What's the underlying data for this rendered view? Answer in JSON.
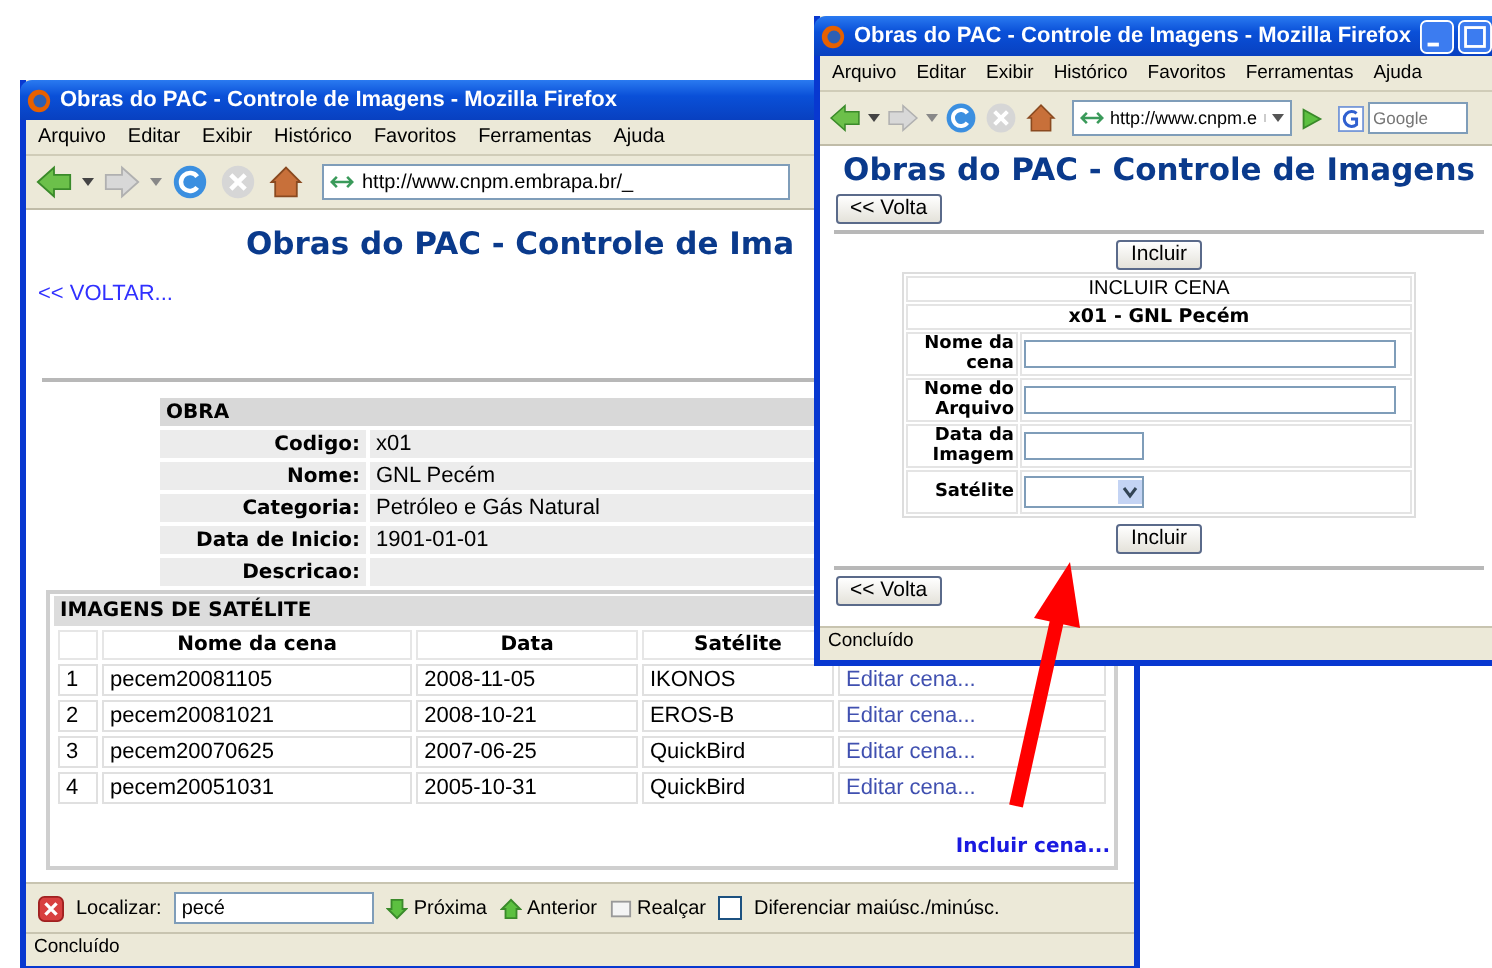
{
  "back_window": {
    "title": "Obras do PAC - Controle de Imagens - Mozilla Firefox",
    "menu": [
      "Arquivo",
      "Editar",
      "Exibir",
      "Histórico",
      "Favoritos",
      "Ferramentas",
      "Ajuda"
    ],
    "url": "http://www.cnpm.embrapa.br/_",
    "page": {
      "heading": "Obras do PAC - Controle de Ima",
      "back_link": "<< VOLTAR...",
      "obra": {
        "heading": "OBRA",
        "fields": [
          {
            "label": "Codigo:",
            "value": "x01"
          },
          {
            "label": "Nome:",
            "value": "GNL Pecém"
          },
          {
            "label": "Categoria:",
            "value": "Petróleo e Gás Natural"
          },
          {
            "label": "Data de Inicio:",
            "value": "1901-01-01"
          },
          {
            "label": "Descricao:"
          }
        ]
      },
      "images": {
        "heading": "IMAGENS DE SATÉLITE",
        "columns": [
          "Nome da cena",
          "Data",
          "Satélite"
        ],
        "rows": [
          {
            "number": "1",
            "name": "pecem20081105",
            "date": "2008-11-05",
            "satellite": "IKONOS",
            "action": "Editar cena..."
          },
          {
            "number": "2",
            "name": "pecem20081021",
            "date": "2008-10-21",
            "satellite": "EROS-B",
            "action": "Editar cena..."
          },
          {
            "number": "3",
            "name": "pecem20070625",
            "date": "2007-06-25",
            "satellite": "QuickBird",
            "action": "Editar cena..."
          },
          {
            "number": "4",
            "name": "pecem20051031",
            "date": "2005-10-31",
            "satellite": "QuickBird",
            "action": "Editar cena..."
          }
        ],
        "add_link": "Incluir cena..."
      }
    },
    "find_bar": {
      "label": "Localizar:",
      "value": "pecé",
      "next": "Próxima",
      "previous": "Anterior",
      "highlight": "Realçar",
      "match_case": {
        "label": "Diferenciar maiúsc./minúsc.",
        "checked": false
      }
    },
    "status": "Concluído"
  },
  "front_window": {
    "title": "Obras do PAC - Controle de Imagens - Mozilla Firefox",
    "menu": [
      "Arquivo",
      "Editar",
      "Exibir",
      "Histórico",
      "Favoritos",
      "Ferramentas",
      "Ajuda"
    ],
    "url": "http://www.cnpm.e",
    "search": {
      "placeholder": "Google"
    },
    "page": {
      "heading": "Obras do PAC - Controle de Imagens",
      "back_button": "<< Volta",
      "include_button": "Incluir",
      "form": {
        "title": "INCLUIR CENA",
        "subtitle": "x01 - GNL Pecém",
        "fields": [
          {
            "label": "Nome da cena",
            "kind": "text"
          },
          {
            "label": "Nome do Arquivo",
            "kind": "text"
          },
          {
            "label": "Data da Imagem",
            "kind": "date"
          },
          {
            "label": "Satélite",
            "kind": "select"
          }
        ],
        "submit": "Incluir"
      },
      "bottom_back_button": "<< Volta"
    },
    "status": "Concluído"
  }
}
